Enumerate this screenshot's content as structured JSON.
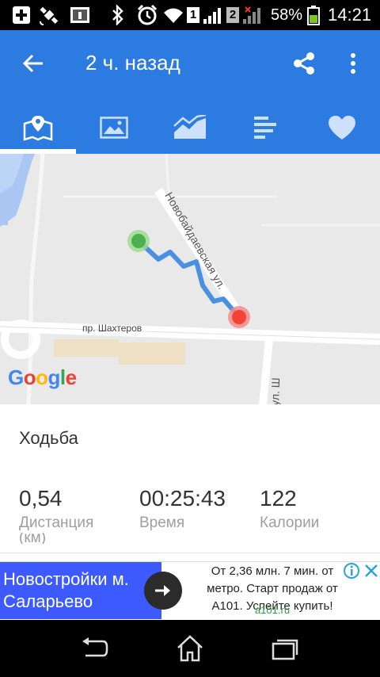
{
  "status_bar": {
    "sim1": "1",
    "sim2": "2",
    "battery_percent": "58%",
    "time": "14:21",
    "battery_level": 0.58,
    "icons": [
      "plus-box-icon",
      "satellite-icon",
      "usb-debug-icon",
      "bluetooth-icon",
      "alarm-icon",
      "wifi-icon",
      "signal-icon",
      "battery-icon"
    ]
  },
  "app_bar": {
    "title": "2 ч. назад",
    "color": "#2c7be0",
    "tabs": [
      {
        "name": "map",
        "icon": "map-icon",
        "selected": true
      },
      {
        "name": "photos",
        "icon": "image-icon",
        "selected": false
      },
      {
        "name": "charts",
        "icon": "chart-icon",
        "selected": false
      },
      {
        "name": "stats",
        "icon": "bars-icon",
        "selected": false
      },
      {
        "name": "favorite",
        "icon": "heart-icon",
        "selected": false
      }
    ]
  },
  "map": {
    "street_vertical": "Новобайдаевская ул.",
    "street_horizontal": "пр. Шахтеров",
    "street_cut": "ул. Ш",
    "logo": "Google",
    "start_color": "#4caf50",
    "end_color": "#f44336",
    "route_color": "#4a90e2"
  },
  "activity": {
    "type": "Ходьба",
    "stats": [
      {
        "value": "0,54",
        "label": "Дистанция"
      },
      {
        "value": "00:25:43",
        "label": "Время"
      },
      {
        "value": "122",
        "label": "Калории"
      }
    ],
    "unit_partial": "(км)"
  },
  "ad": {
    "headline_line1": "Новостройки м.",
    "headline_line2": "Саларьево",
    "text_line1": "От 2,36 млн. 7 мин. от",
    "text_line2": "метро. Старт продаж от",
    "text_line3": "А101. Успейте купить!",
    "domain": "a101.ru"
  }
}
